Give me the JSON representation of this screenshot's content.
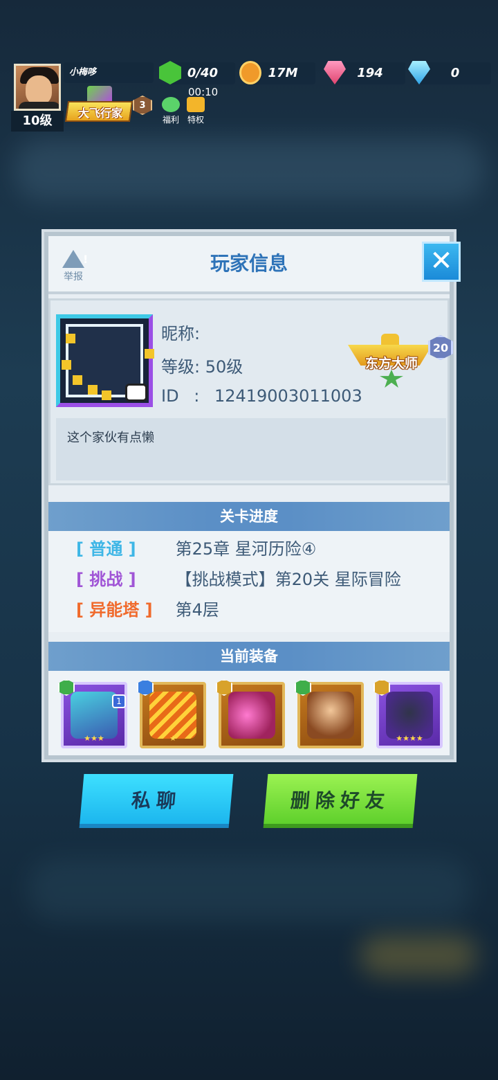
{
  "hud": {
    "player_level": "10级",
    "player_name": "小梅哆",
    "title_badge": "大飞行家",
    "title_rank": "3",
    "timer": "00:10",
    "welfare_label": "福利",
    "privilege_label": "特权",
    "energy": "0/40",
    "coins": "17M",
    "gems": "194",
    "diamonds": "0"
  },
  "dialog": {
    "title": "玩家信息",
    "report_label": "举报",
    "close_glyph": "✕",
    "nickname_label": "昵称:",
    "level_label": "等级:",
    "level_value": "50级",
    "id_label": "ID",
    "id_sep": ":",
    "id_value": "12419003011003",
    "badge_title": "东方大师",
    "badge_level": "20",
    "signature": "这个家伙有点懒"
  },
  "progress": {
    "title": "关卡进度",
    "rows": [
      {
        "tag": "[ 普通 ]",
        "value": "第25章  星河历险④"
      },
      {
        "tag": "[ 挑战 ]",
        "value": "【挑战模式】第20关 星际冒险"
      },
      {
        "tag": "[ 异能塔 ]",
        "value": "第4层"
      }
    ]
  },
  "equipment": {
    "title": "当前装备",
    "items": [
      {
        "icon": "robot-raccoon-icon",
        "stars": "★★★",
        "level": "1"
      },
      {
        "icon": "fire-missiles-icon",
        "stars": "★"
      },
      {
        "icon": "pink-blade-icon",
        "stars": ""
      },
      {
        "icon": "monkey-king-icon",
        "stars": ""
      },
      {
        "icon": "shadow-wolf-icon",
        "stars": "★★★★"
      }
    ]
  },
  "buttons": {
    "chat": "私聊",
    "delete_friend": "删除好友"
  },
  "colors": {
    "accent_blue": "#2e73b8",
    "normal_tag": "#3eb6e6",
    "challenge_tag": "#a055d6",
    "tower_tag": "#f06a2c"
  }
}
